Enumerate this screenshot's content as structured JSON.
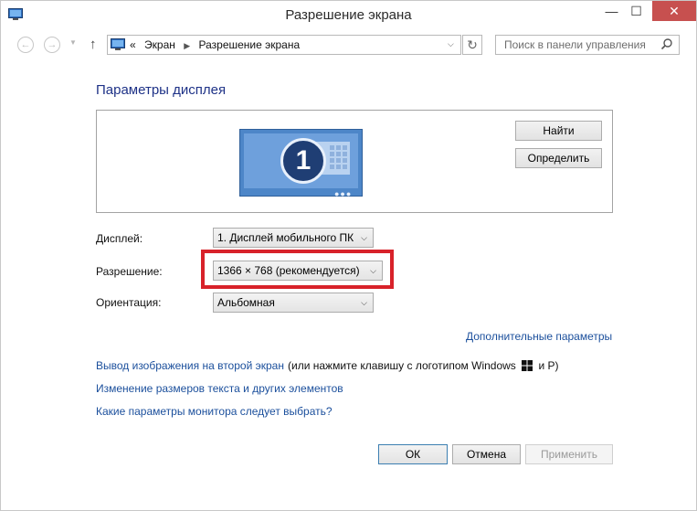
{
  "window": {
    "title": "Разрешение экрана",
    "controls": {
      "minimize": "—",
      "maximize": "☐",
      "close": "✕"
    },
    "icon": "display-settings-icon"
  },
  "navbar": {
    "back": "←",
    "forward": "→",
    "recent": "▼",
    "up": "↑",
    "address": {
      "prefix": "«",
      "crumbs": [
        "Экран",
        "Разрешение экрана"
      ],
      "separator": "▶",
      "dropdown": "⌵"
    },
    "refresh": "↻",
    "search_placeholder": "Поиск в панели управления"
  },
  "main": {
    "heading": "Параметры дисплея",
    "monitor_number": "1",
    "monitor_dots": "●●●",
    "find_button": "Найти",
    "identify_button": "Определить",
    "display_label": "Дисплей:",
    "display_value": "1. Дисплей мобильного ПК",
    "resolution_label": "Разрешение:",
    "resolution_value": "1366 × 768 (рекомендуется)",
    "orientation_label": "Ориентация:",
    "orientation_value": "Альбомная",
    "dropdown_arrow": "⌵",
    "advanced_link": "Дополнительные параметры",
    "second_screen_link": "Вывод изображения на второй экран",
    "second_screen_text_before": "(или нажмите клавишу с логотипом Windows",
    "second_screen_text_after": "и P)",
    "text_size_link": "Изменение размеров текста и других элементов",
    "monitor_help_link": "Какие параметры монитора следует выбрать?"
  },
  "footer": {
    "ok": "ОК",
    "cancel": "Отмена",
    "apply": "Применить"
  },
  "colors": {
    "link": "#1b4f9c",
    "heading": "#1e3287",
    "highlight": "#d8222a",
    "close": "#c7504f",
    "monitor": "#4d86c8"
  }
}
